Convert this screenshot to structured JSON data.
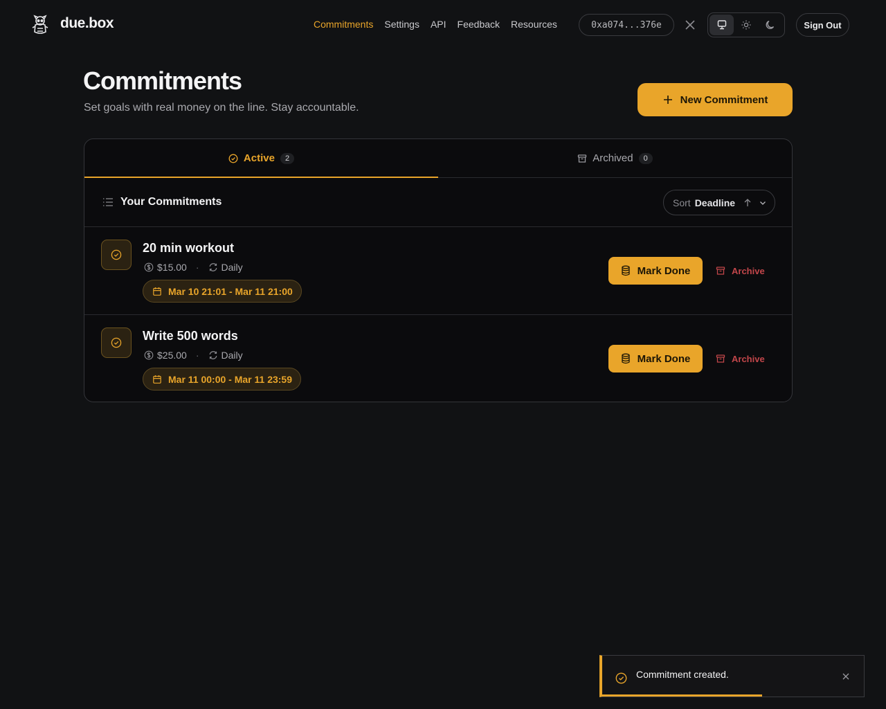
{
  "brand": {
    "name": "due.box",
    "logo_icon": "mascot-logo-icon"
  },
  "nav": {
    "items": [
      {
        "label": "Commitments",
        "active": true
      },
      {
        "label": "Settings",
        "active": false
      },
      {
        "label": "API",
        "active": false
      },
      {
        "label": "Feedback",
        "active": false
      },
      {
        "label": "Resources",
        "active": false
      }
    ],
    "wallet_address": "0xa074...376e",
    "social_icon": "x-logo-icon",
    "theme_options": [
      {
        "icon": "monitor-icon",
        "selected": true
      },
      {
        "icon": "sun-icon",
        "selected": false
      },
      {
        "icon": "moon-icon",
        "selected": false
      }
    ],
    "sign_out_label": "Sign Out"
  },
  "page": {
    "title": "Commitments",
    "subtitle": "Set goals with real money on the line. Stay accountable.",
    "new_button_label": "New Commitment"
  },
  "tabs": [
    {
      "label": "Active",
      "count": "2",
      "icon": "check-circle-icon",
      "active": true
    },
    {
      "label": "Archived",
      "count": "0",
      "icon": "archive-icon",
      "active": false
    }
  ],
  "list": {
    "title": "Your Commitments",
    "sort_label": "Sort",
    "sort_value": "Deadline",
    "sort_direction": "ascending"
  },
  "commitments": [
    {
      "title": "20 min workout",
      "amount": "$15.00",
      "frequency": "Daily",
      "date_range": "Mar 10 21:01 - Mar 11 21:00",
      "done_label": "Mark Done",
      "archive_label": "Archive"
    },
    {
      "title": "Write 500 words",
      "amount": "$25.00",
      "frequency": "Daily",
      "date_range": "Mar 11 00:00 - Mar 11 23:59",
      "done_label": "Mark Done",
      "archive_label": "Archive"
    }
  ],
  "toast": {
    "message": "Commitment created.",
    "progress": 0.61
  },
  "colors": {
    "accent": "#e9a52a",
    "background": "#111214",
    "danger": "#c2464a"
  }
}
